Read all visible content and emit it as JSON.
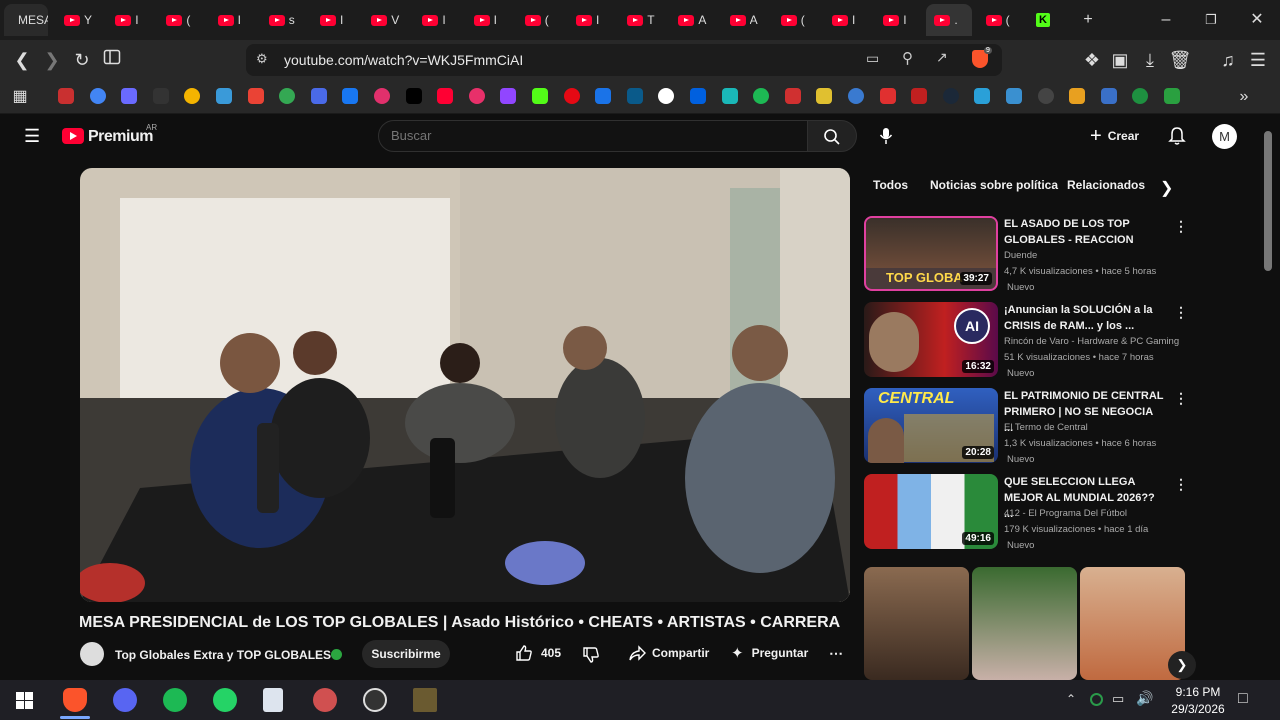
{
  "browser": {
    "tabs": [
      {
        "title": "MESA"
      },
      {
        "title": "Y"
      },
      {
        "title": "I"
      },
      {
        "title": "("
      },
      {
        "title": "I"
      },
      {
        "title": "s"
      },
      {
        "title": "I"
      },
      {
        "title": "V"
      },
      {
        "title": "I"
      },
      {
        "title": "I"
      },
      {
        "title": "("
      },
      {
        "title": "I"
      },
      {
        "title": "T"
      },
      {
        "title": "A"
      },
      {
        "title": "A"
      },
      {
        "title": "("
      },
      {
        "title": "I"
      },
      {
        "title": "I"
      },
      {
        "title": "."
      },
      {
        "title": "("
      },
      {
        "title": "K"
      }
    ],
    "url": "youtube.com/watch?v=WKJ5FmmCiAI",
    "brave_badge": "9"
  },
  "youtube": {
    "logo_text": "Premium",
    "region": "AR",
    "search_placeholder": "Buscar",
    "create_label": "Crear",
    "avatar_letter": "M",
    "video_title": "MESA PRESIDENCIAL de LOS TOP GLOBALES | Asado Histórico • CHEATS • ARTISTAS • CARRERA",
    "channel_name": "Top Globales Extra y TOP GLOBALES",
    "subscribe_label": "Suscribirme",
    "like_count": "405",
    "share_label": "Compartir",
    "ask_label": "Preguntar",
    "chips": [
      "Todos",
      "Noticias sobre política",
      "Relacionados"
    ],
    "recommendations": [
      {
        "title": "EL ASADO DE LOS TOP GLOBALES - REACCION",
        "channel": "Duende",
        "verified": true,
        "meta": "4,7 K visualizaciones • hace 5 horas",
        "badge": "Nuevo",
        "duration": "39:27",
        "thumb_text": "TOP GLOBA"
      },
      {
        "title": "¡Anuncian la SOLUCIÓN a la CRISIS de RAM... y los ...",
        "channel": "Rincón de Varo - Hardware & PC Gaming",
        "verified": true,
        "meta": "51 K visualizaciones • hace 7 horas",
        "badge": "Nuevo",
        "duration": "16:32",
        "thumb_text": "AI"
      },
      {
        "title": "EL PATRIMONIO DE CENTRAL PRIMERO | NO SE NEGOCIA ...",
        "channel": "El Termo de Central",
        "verified": false,
        "meta": "1,3 K visualizaciones • hace 6 horas",
        "badge": "Nuevo",
        "duration": "20:28",
        "thumb_text": "CENTRAL"
      },
      {
        "title": "QUE SELECCION LLEGA MEJOR AL MUNDIAL 2026?? ...",
        "channel": "412 - El Programa Del Fútbol",
        "verified": true,
        "meta": "179 K visualizaciones • hace 1 día",
        "badge": "Nuevo",
        "duration": "49:16",
        "thumb_text": ""
      }
    ]
  },
  "taskbar": {
    "time": "9:16 PM",
    "date": "29/3/2026"
  },
  "colors": {
    "accent_red": "#ff0033",
    "bg": "#0f0f0f"
  }
}
